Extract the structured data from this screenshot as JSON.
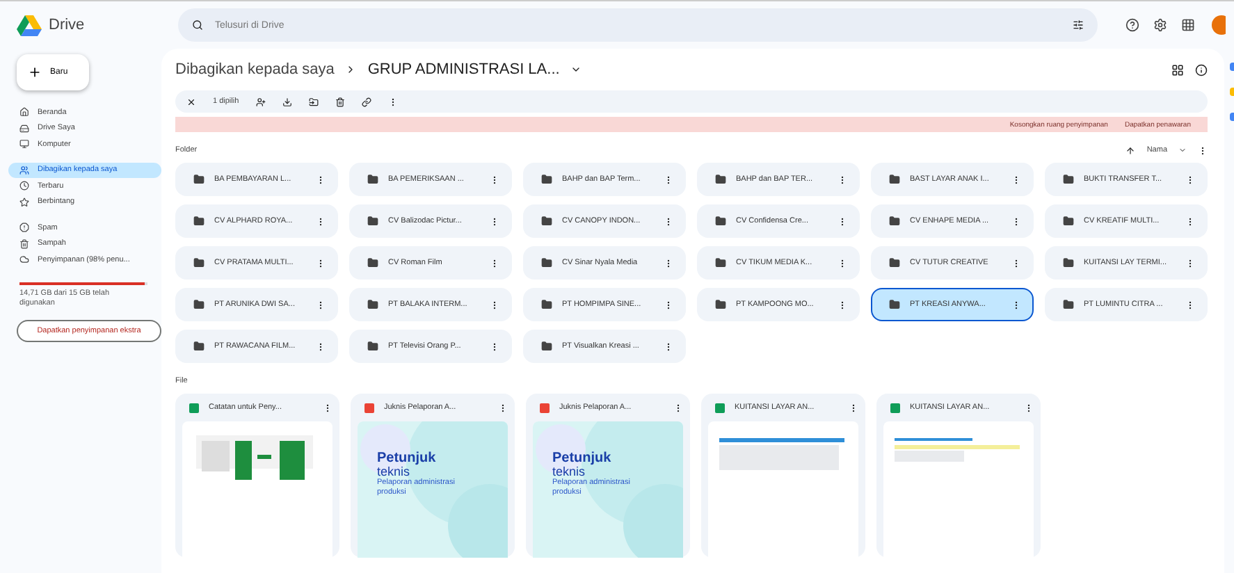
{
  "app": {
    "name": "Drive"
  },
  "search": {
    "placeholder": "Telusuri di Drive"
  },
  "sidebar": {
    "new_button": "Baru",
    "groups": [
      [
        {
          "label": "Beranda",
          "selected": false
        },
        {
          "label": "Drive Saya",
          "selected": false
        },
        {
          "label": "Komputer",
          "selected": false
        }
      ],
      [
        {
          "label": "Dibagikan kepada saya",
          "selected": true
        },
        {
          "label": "Terbaru",
          "selected": false
        },
        {
          "label": "Berbintang",
          "selected": false
        }
      ],
      [
        {
          "label": "Spam",
          "selected": false
        },
        {
          "label": "Sampah",
          "selected": false
        },
        {
          "label": "Penyimpanan (98% penu...",
          "selected": false
        }
      ]
    ],
    "storage": {
      "level": 0.98,
      "text": "14,71 GB dari 15 GB telah digunakan"
    },
    "storage_button": "Dapatkan penyimpanan ekstra"
  },
  "breadcrumb": [
    "Dibagikan kepada saya",
    "GRUP ADMINISTRASI LA..."
  ],
  "selection_bar": {
    "count": "1 dipilih"
  },
  "banner": {
    "actions": [
      "Kosongkan ruang penyimpanan",
      "Dapatkan penawaran"
    ]
  },
  "folders": {
    "heading": "Folder",
    "sort": "Nama",
    "items": [
      {
        "name": "BA PEMBAYARAN L...",
        "selected": false
      },
      {
        "name": "BA PEMERIKSAAN ...",
        "selected": false
      },
      {
        "name": "BAHP dan BAP Term...",
        "selected": false
      },
      {
        "name": "BAHP dan BAP TER...",
        "selected": false
      },
      {
        "name": "BAST LAYAR ANAK I...",
        "selected": false
      },
      {
        "name": "BUKTI TRANSFER T...",
        "selected": false
      },
      {
        "name": "CV ALPHARD ROYA...",
        "selected": false
      },
      {
        "name": "CV Balizodac Pictur...",
        "selected": false
      },
      {
        "name": "CV CANOPY INDON...",
        "selected": false
      },
      {
        "name": "CV Confidensa Cre...",
        "selected": false
      },
      {
        "name": "CV ENHAPE MEDIA ...",
        "selected": false
      },
      {
        "name": "CV KREATIF MULTI...",
        "selected": false
      },
      {
        "name": "CV PRATAMA MULTI...",
        "selected": false
      },
      {
        "name": "CV Roman Film",
        "selected": false
      },
      {
        "name": "CV Sinar Nyala Media",
        "selected": false
      },
      {
        "name": "CV TIKUM MEDIA K...",
        "selected": false
      },
      {
        "name": "CV TUTUR CREATIVE",
        "selected": false
      },
      {
        "name": "KUITANSI LAY TERMI...",
        "selected": false
      },
      {
        "name": "PT ARUNIKA DWI SA...",
        "selected": false
      },
      {
        "name": "PT BALAKA INTERM...",
        "selected": false
      },
      {
        "name": "PT HOMPIMPA SINE...",
        "selected": false
      },
      {
        "name": "PT KAMPOONG MO...",
        "selected": false
      },
      {
        "name": "PT KREASI ANYWA...",
        "selected": true
      },
      {
        "name": "PT LUMINTU CITRA ...",
        "selected": false
      },
      {
        "name": "PT RAWACANA FILM...",
        "selected": false
      },
      {
        "name": "PT Televisi Orang P...",
        "selected": false
      },
      {
        "name": "PT Visualkan Kreasi ...",
        "selected": false
      }
    ]
  },
  "files": {
    "heading": "File",
    "items": [
      {
        "name": "Catatan untuk Peny...",
        "kind": "sheet"
      },
      {
        "name": "Juknis Pelaporan A...",
        "kind": "pdf",
        "preview": {
          "title": "Petunjuk",
          "subtitle": "teknis",
          "text": "Pelaporan administrasi produksi"
        }
      },
      {
        "name": "Juknis Pelaporan A...",
        "kind": "pdf",
        "preview": {
          "title": "Petunjuk",
          "subtitle": "teknis",
          "text": "Pelaporan administrasi produksi"
        }
      },
      {
        "name": "KUITANSI LAYAR AN...",
        "kind": "sheet"
      },
      {
        "name": "KUITANSI LAYAR AN...",
        "kind": "sheet"
      }
    ]
  }
}
